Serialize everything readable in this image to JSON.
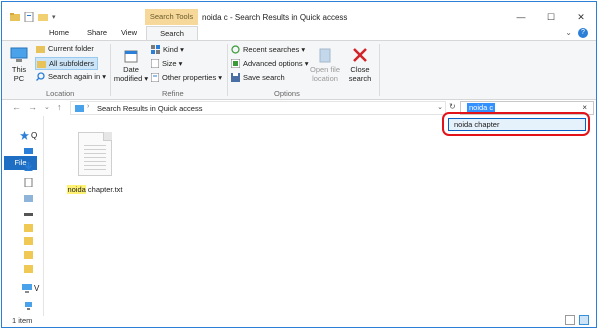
{
  "window": {
    "title": "noida c - Search Results in Quick access",
    "context_tab": "Search Tools",
    "minimize": "—",
    "maximize": "☐",
    "close": "✕"
  },
  "tabs": {
    "file": "File",
    "home": "Home",
    "share": "Share",
    "view": "View",
    "search": "Search"
  },
  "ribbon": {
    "location": {
      "label": "Location",
      "this_pc": "This\nPC",
      "current_folder": "Current folder",
      "all_subfolders": "All subfolders",
      "search_again": "Search again in ▾"
    },
    "refine": {
      "label": "Refine",
      "date_modified": "Date\nmodified ▾",
      "kind": "Kind ▾",
      "size": "Size ▾",
      "other_properties": "Other properties ▾"
    },
    "options": {
      "label": "Options",
      "recent_searches": "Recent searches ▾",
      "advanced_options": "Advanced options ▾",
      "save_search": "Save search",
      "open_file_location": "Open file\nlocation",
      "close_search": "Close\nsearch"
    }
  },
  "address": {
    "path": "Search Results in Quick access",
    "search_value": "noida c",
    "suggestion": "noida chapter"
  },
  "nav": {
    "quick_access_letter": "Q",
    "this_pc_letter": "V"
  },
  "files": [
    {
      "name_highlight": "noida",
      "name_rest": " chapter.txt"
    }
  ],
  "status": {
    "item_count": "1 item"
  },
  "colors": {
    "accent": "#1e6fc4",
    "highlight": "#fff171",
    "annotation": "#e2141a"
  }
}
